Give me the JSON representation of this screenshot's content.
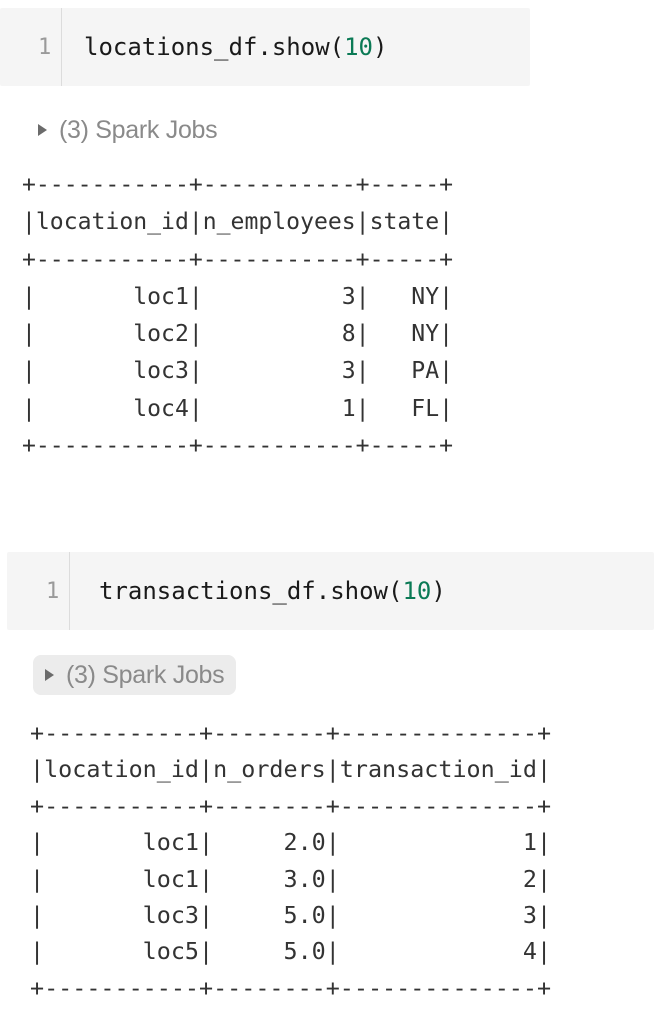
{
  "cells": [
    {
      "line_number": "1",
      "code_prefix": "locations_df.show(",
      "code_arg": "10",
      "code_suffix": ")",
      "spark_jobs": "(3) Spark Jobs",
      "output_lines": [
        "+-----------+-----------+-----+",
        "|location_id|n_employees|state|",
        "+-----------+-----------+-----+",
        "|       loc1|          3|   NY|",
        "|       loc2|          8|   NY|",
        "|       loc3|          3|   PA|",
        "|       loc4|          1|   FL|",
        "+-----------+-----------+-----+"
      ]
    },
    {
      "line_number": "1",
      "code_prefix": "transactions_df.show(",
      "code_arg": "10",
      "code_suffix": ")",
      "spark_jobs": "(3) Spark Jobs",
      "output_lines": [
        "+-----------+--------+--------------+",
        "|location_id|n_orders|transaction_id|",
        "+-----------+--------+--------------+",
        "|       loc1|     2.0|             1|",
        "|       loc1|     3.0|             2|",
        "|       loc3|     5.0|             3|",
        "|       loc5|     5.0|             4|",
        "+-----------+--------+--------------+"
      ]
    }
  ],
  "colors": {
    "cell_bg": "#f5f5f5",
    "number_literal": "#0b7a55",
    "muted_text": "#8a8a8a"
  },
  "icons": {
    "expand": "triangle-right-icon"
  }
}
